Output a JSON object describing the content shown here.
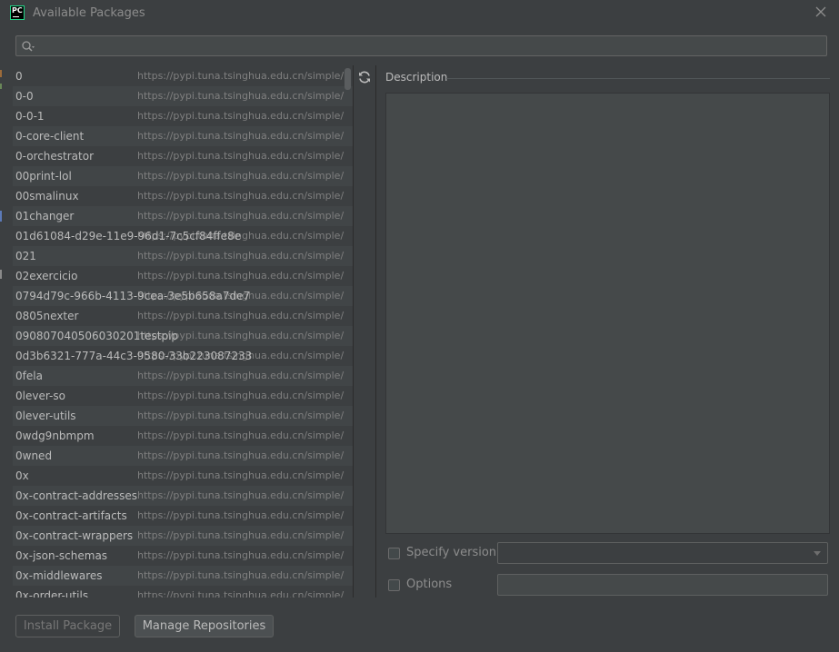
{
  "window": {
    "title": "Available Packages",
    "app_logo_text": "PC"
  },
  "search": {
    "value": "",
    "placeholder": ""
  },
  "packages": [
    {
      "name": "0",
      "repo": "https://pypi.tuna.tsinghua.edu.cn/simple/"
    },
    {
      "name": "0-0",
      "repo": "https://pypi.tuna.tsinghua.edu.cn/simple/"
    },
    {
      "name": "0-0-1",
      "repo": "https://pypi.tuna.tsinghua.edu.cn/simple/"
    },
    {
      "name": "0-core-client",
      "repo": "https://pypi.tuna.tsinghua.edu.cn/simple/"
    },
    {
      "name": "0-orchestrator",
      "repo": "https://pypi.tuna.tsinghua.edu.cn/simple/"
    },
    {
      "name": "00print-lol",
      "repo": "https://pypi.tuna.tsinghua.edu.cn/simple/"
    },
    {
      "name": "00smalinux",
      "repo": "https://pypi.tuna.tsinghua.edu.cn/simple/"
    },
    {
      "name": "01changer",
      "repo": "https://pypi.tuna.tsinghua.edu.cn/simple/"
    },
    {
      "name": "01d61084-d29e-11e9-96d1-7c5cf84ffe8e",
      "repo": "https://pypi.tuna.tsinghua.edu.cn/simple/"
    },
    {
      "name": "021",
      "repo": "https://pypi.tuna.tsinghua.edu.cn/simple/"
    },
    {
      "name": "02exercicio",
      "repo": "https://pypi.tuna.tsinghua.edu.cn/simple/"
    },
    {
      "name": "0794d79c-966b-4113-9cea-3e5b658a7de7",
      "repo": "https://pypi.tuna.tsinghua.edu.cn/simple/"
    },
    {
      "name": "0805nexter",
      "repo": "https://pypi.tuna.tsinghua.edu.cn/simple/"
    },
    {
      "name": "090807040506030201testpip",
      "repo": "https://pypi.tuna.tsinghua.edu.cn/simple/"
    },
    {
      "name": "0d3b6321-777a-44c3-9580-33b223087233",
      "repo": "https://pypi.tuna.tsinghua.edu.cn/simple/"
    },
    {
      "name": "0fela",
      "repo": "https://pypi.tuna.tsinghua.edu.cn/simple/"
    },
    {
      "name": "0lever-so",
      "repo": "https://pypi.tuna.tsinghua.edu.cn/simple/"
    },
    {
      "name": "0lever-utils",
      "repo": "https://pypi.tuna.tsinghua.edu.cn/simple/"
    },
    {
      "name": "0wdg9nbmpm",
      "repo": "https://pypi.tuna.tsinghua.edu.cn/simple/"
    },
    {
      "name": "0wned",
      "repo": "https://pypi.tuna.tsinghua.edu.cn/simple/"
    },
    {
      "name": "0x",
      "repo": "https://pypi.tuna.tsinghua.edu.cn/simple/"
    },
    {
      "name": "0x-contract-addresses",
      "repo": "https://pypi.tuna.tsinghua.edu.cn/simple/"
    },
    {
      "name": "0x-contract-artifacts",
      "repo": "https://pypi.tuna.tsinghua.edu.cn/simple/"
    },
    {
      "name": "0x-contract-wrappers",
      "repo": "https://pypi.tuna.tsinghua.edu.cn/simple/"
    },
    {
      "name": "0x-json-schemas",
      "repo": "https://pypi.tuna.tsinghua.edu.cn/simple/"
    },
    {
      "name": "0x-middlewares",
      "repo": "https://pypi.tuna.tsinghua.edu.cn/simple/"
    },
    {
      "name": "0x-order-utils",
      "repo": "https://pypi.tuna.tsinghua.edu.cn/simple/"
    }
  ],
  "description": {
    "label": "Description",
    "text": ""
  },
  "options": {
    "specify_version_label": "Specify version",
    "specify_version_checked": false,
    "version_value": "",
    "options_label": "Options",
    "options_checked": false,
    "options_value": ""
  },
  "buttons": {
    "install": "Install Package",
    "manage": "Manage Repositories"
  },
  "icons": {
    "logo": "pycharm-logo-icon",
    "close": "close-icon",
    "search": "search-icon",
    "refresh": "refresh-icon",
    "dropdown": "chevron-down-icon"
  },
  "colors": {
    "background": "#3c3f41",
    "text": "#bbbbbb",
    "muted": "#7f7f7f",
    "logo_accent": "#21d789"
  }
}
